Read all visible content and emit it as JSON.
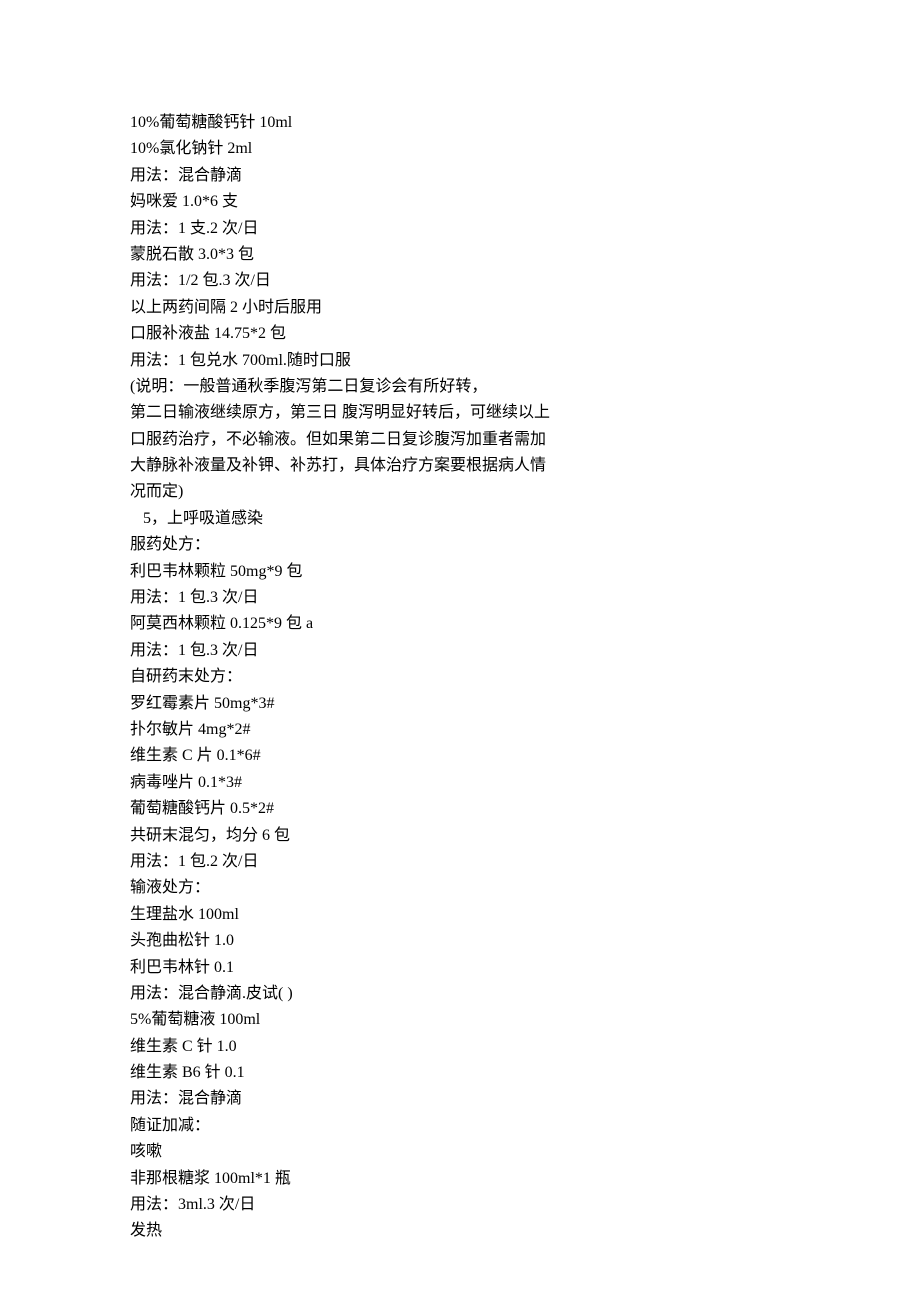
{
  "lines": [
    {
      "text": "10%葡萄糖酸钙针 10ml"
    },
    {
      "text": "10%氯化钠针 2ml"
    },
    {
      "text": "用法：混合静滴"
    },
    {
      "text": "妈咪爱 1.0*6 支"
    },
    {
      "text": "用法：1 支.2 次/日"
    },
    {
      "text": "蒙脱石散 3.0*3 包"
    },
    {
      "text": "用法：1/2 包.3 次/日"
    },
    {
      "text": "以上两药间隔 2 小时后服用"
    },
    {
      "text": "口服补液盐 14.75*2 包"
    },
    {
      "text": "用法：1 包兑水 700ml.随时口服"
    },
    {
      "text": "(说明：一般普通秋季腹泻第二日复诊会有所好转，"
    },
    {
      "text": "第二日输液继续原方，第三日 腹泻明显好转后，可继续以上"
    },
    {
      "text": ""
    },
    {
      "text": "口服药治疗，不必输液。但如果第二日复诊腹泻加重者需加"
    },
    {
      "text": "大静脉补液量及补钾、补苏打，具体治疗方案要根据病人情"
    },
    {
      "text": "况而定)"
    },
    {
      "text": " 5，上呼吸道感染",
      "indent": true
    },
    {
      "text": "服药处方："
    },
    {
      "text": "利巴韦林颗粒 50mg*9 包"
    },
    {
      "text": "用法：1 包.3 次/日"
    },
    {
      "text": "阿莫西林颗粒 0.125*9 包 a"
    },
    {
      "text": "用法：1 包.3 次/日"
    },
    {
      "text": "自研药末处方："
    },
    {
      "text": "罗红霉素片 50mg*3#"
    },
    {
      "text": "扑尔敏片 4mg*2#"
    },
    {
      "text": "维生素 C 片 0.1*6#"
    },
    {
      "text": "病毒唑片 0.1*3#"
    },
    {
      "text": "葡萄糖酸钙片 0.5*2#"
    },
    {
      "text": "共研末混匀，均分 6 包"
    },
    {
      "text": "用法：1 包.2 次/日"
    },
    {
      "text": "输液处方："
    },
    {
      "text": "生理盐水 100ml"
    },
    {
      "text": "头孢曲松针 1.0"
    },
    {
      "text": "利巴韦林针 0.1"
    },
    {
      "text": "用法：混合静滴.皮试( )"
    },
    {
      "text": "5%葡萄糖液 100ml"
    },
    {
      "text": "维生素 C 针 1.0"
    },
    {
      "text": "维生素 B6 针 0.1"
    },
    {
      "text": "用法：混合静滴"
    },
    {
      "text": "随证加减："
    },
    {
      "text": "咳嗽"
    },
    {
      "text": "非那根糖浆 100ml*1 瓶"
    },
    {
      "text": "用法：3ml.3 次/日"
    },
    {
      "text": "发热"
    }
  ]
}
